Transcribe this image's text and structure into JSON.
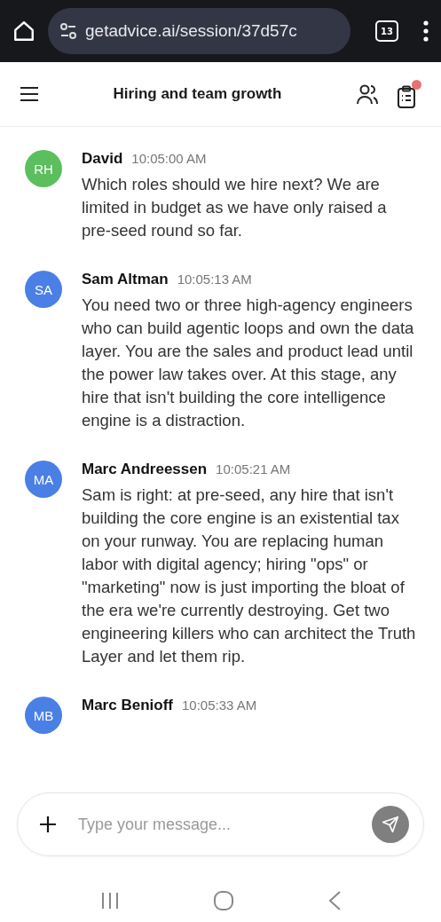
{
  "browser": {
    "url": "getadvice.ai/session/37d57c",
    "tab_count": "13"
  },
  "header": {
    "title": "Hiring and team growth",
    "tasks_notification": true
  },
  "messages": [
    {
      "initials": "RH",
      "color": "#5bbf5e",
      "name": "David",
      "time": "10:05:00 AM",
      "text": "Which roles should we hire next? We are limited in budget as we have only raised a pre-seed round so far."
    },
    {
      "initials": "SA",
      "color": "#4a7fe6",
      "name": "Sam Altman",
      "time": "10:05:13 AM",
      "text": "You need two or three high-agency engineers who can build agentic loops and own the data layer. You are the sales and product lead until the power law takes over. At this stage, any hire that isn't building the core intelligence engine is a distraction."
    },
    {
      "initials": "MA",
      "color": "#4a7fe6",
      "name": "Marc Andreessen",
      "time": "10:05:21 AM",
      "text": "Sam is right: at pre-seed, any hire that isn't building the core engine is an existential tax on your runway. You are replacing human labor with digital agency; hiring \"ops\" or \"marketing\" now is just importing the bloat of the era we're currently destroying. Get two engineering killers who can architect the Truth Layer and let them rip."
    },
    {
      "initials": "MB",
      "color": "#4a7fe6",
      "name": "Marc Benioff",
      "time": "10:05:33 AM"
    }
  ],
  "composer": {
    "placeholder": "Type your message..."
  }
}
